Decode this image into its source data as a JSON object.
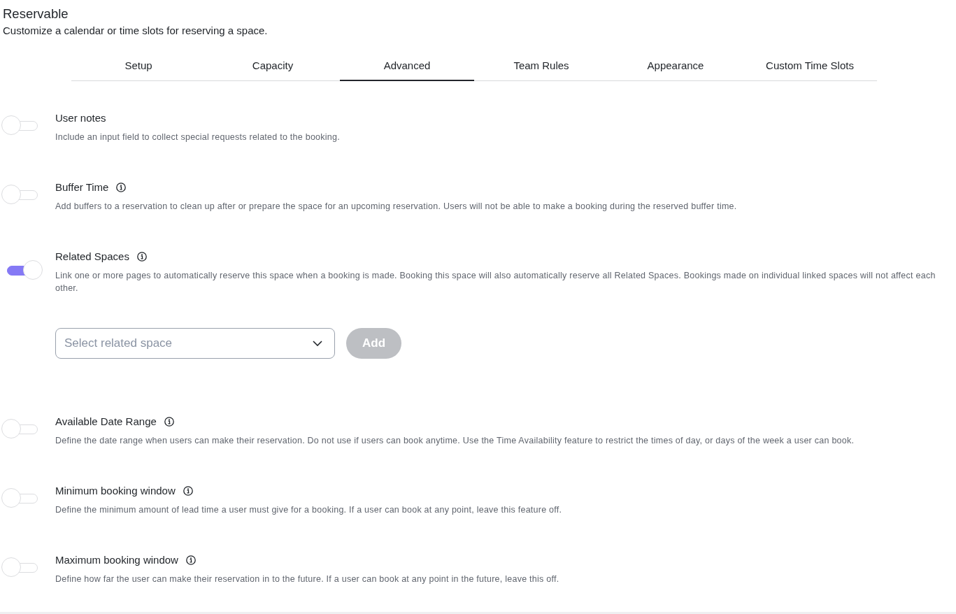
{
  "page": {
    "title": "Reservable",
    "subtitle": "Customize a calendar or time slots for reserving a space."
  },
  "tabs": [
    {
      "label": "Setup",
      "selected": false
    },
    {
      "label": "Capacity",
      "selected": false
    },
    {
      "label": "Advanced",
      "selected": true
    },
    {
      "label": "Team Rules",
      "selected": false
    },
    {
      "label": "Appearance",
      "selected": false
    },
    {
      "label": "Custom Time Slots",
      "selected": false
    }
  ],
  "settings": [
    {
      "title": "User notes",
      "info_icon": false,
      "on": false,
      "description": "Include an input field to collect special requests related to the booking."
    },
    {
      "title": "Buffer Time",
      "info_icon": true,
      "on": false,
      "description": "Add buffers to a reservation to clean up after or prepare the space for an upcoming reservation. Users will not be able to make a booking during the reserved buffer time."
    },
    {
      "title": "Related Spaces",
      "info_icon": true,
      "on": true,
      "description": "Link one or more pages to automatically reserve this space when a booking is made. Booking this space will also automatically reserve all Related Spaces. Bookings made on individual linked spaces will not affect each other.",
      "picker": {
        "placeholder": "Select related space",
        "add_button": {
          "label": "Add",
          "disabled": true
        }
      }
    },
    {
      "title": "Available Date Range",
      "info_icon": true,
      "on": false,
      "description": "Define the date range when users can make their reservation. Do not use if users can book anytime. Use the Time Availability feature to restrict the times of day, or days of the week a user can book."
    },
    {
      "title": "Minimum booking window",
      "info_icon": true,
      "on": false,
      "description": "Define the minimum amount of lead time a user must give for a booking. If a user can book at any point, leave this feature off."
    },
    {
      "title": "Maximum booking window",
      "info_icon": true,
      "on": false,
      "description": "Define how far the user can make their reservation in to the future. If a user can book at any point in the future, leave this off."
    }
  ]
}
